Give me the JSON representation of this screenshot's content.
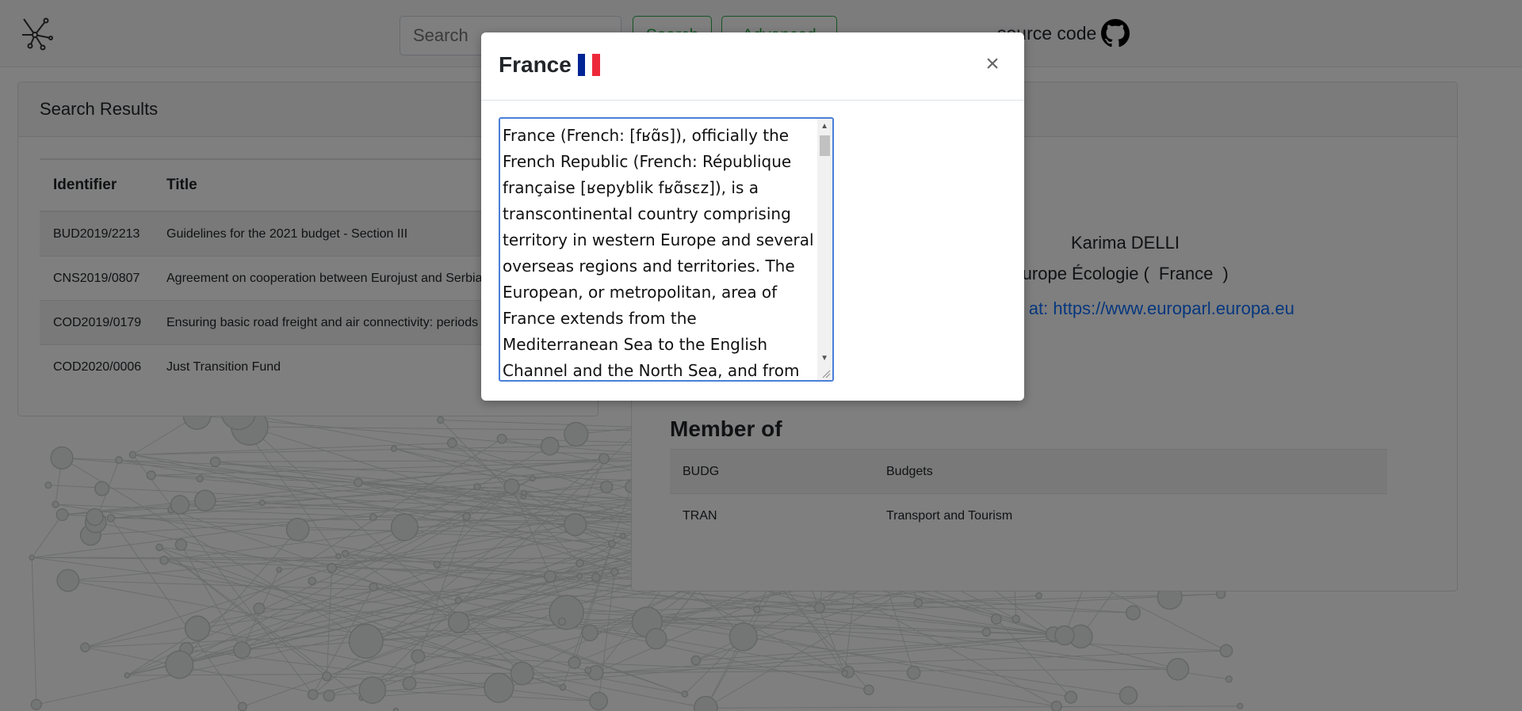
{
  "navbar": {
    "search_placeholder": "Search",
    "search_button": "Search",
    "advanced_button": "Advanced",
    "source_link": "source code"
  },
  "results": {
    "header": "Search Results",
    "columns": [
      "Identifier",
      "Title"
    ],
    "rows": [
      {
        "id": "BUD2019/2213",
        "title": "Guidelines for the 2021 budget - Section III"
      },
      {
        "id": "CNS2019/0807",
        "title": "Agreement on cooperation between Eurojust and Serbia"
      },
      {
        "id": "COD2019/0179",
        "title": "Ensuring basic road freight and air connectivity: periods o"
      },
      {
        "id": "COD2020/0006",
        "title": "Just Transition Fund"
      }
    ]
  },
  "mep": {
    "name": "Karima DELLI",
    "party_prefix": "Europe Écologie (",
    "country": "France",
    "party_suffix": ")",
    "link_text": "E at: https://www.europarl.europa.eu",
    "member_of_heading": "Member of",
    "memberships": [
      {
        "code": "BUDG",
        "name": "Budgets"
      },
      {
        "code": "TRAN",
        "name": "Transport and Tourism"
      }
    ]
  },
  "modal": {
    "title": "France",
    "close_symbol": "×",
    "description": "France (French: [fʁɑ̃s]), officially the French Republic (French: République française [ʁepyblik fʁɑ̃sɛz]), is a transcontinental country comprising territory in western Europe and several overseas regions and territories. The European, or metropolitan, area of France extends from the Mediterranean Sea to the English Channel and the North Sea, and from the Rhine to the Atlantic Ocean.",
    "flag_colors": [
      "#002395",
      "#ffffff",
      "#ed2939"
    ]
  },
  "icons": {
    "logo": "network-graph-icon",
    "github": "github-icon",
    "close": "close-icon"
  }
}
